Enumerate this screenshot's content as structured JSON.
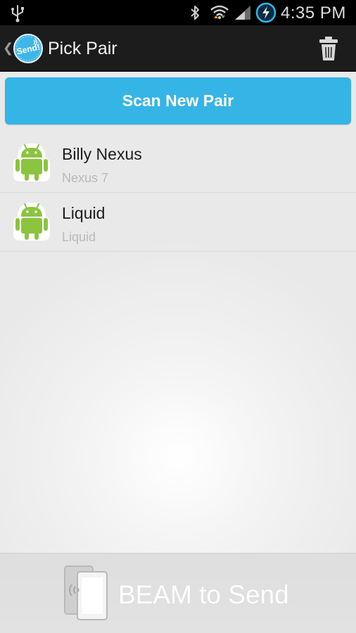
{
  "status_bar": {
    "time": "4:35 PM",
    "icons": [
      "usb-icon",
      "bluetooth-icon",
      "wifi-icon",
      "signal-icon",
      "battery-charging-icon"
    ]
  },
  "action_bar": {
    "title": "Pick Pair",
    "logo_text": "Send!",
    "trash_icon": "trash-icon"
  },
  "scan_button": {
    "label": "Scan New Pair",
    "color": "#35b4e6"
  },
  "devices": [
    {
      "name": "Billy Nexus",
      "model": "Nexus 7",
      "icon": "android-icon"
    },
    {
      "name": "Liquid",
      "model": "Liquid",
      "icon": "android-icon"
    }
  ],
  "beam_bar": {
    "label": "BEAM to Send",
    "icon": "nfc-beam-icon"
  },
  "colors": {
    "accent": "#35b4e6",
    "android_green": "#8bc43f",
    "action_bar": "#1c1c1c"
  }
}
